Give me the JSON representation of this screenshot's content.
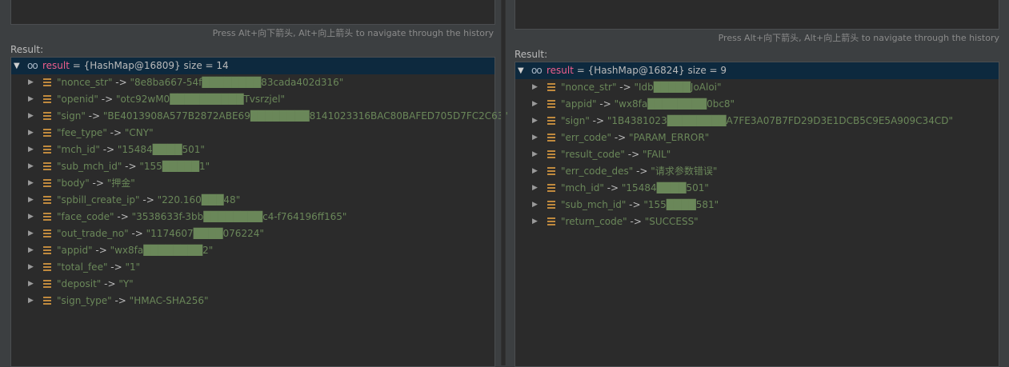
{
  "left": {
    "hint": "Press Alt+向下箭头, Alt+向上箭头 to navigate through the history",
    "result_label": "Result:",
    "root": {
      "name": "result",
      "equals": " = ",
      "type": "{HashMap@16809}",
      "size": "  size = 14"
    },
    "entries": [
      {
        "key": "\"nonce_str\"",
        "value": "\"8e8ba667-54f████████83cada402d316\""
      },
      {
        "key": "\"openid\"",
        "value": "\"otc92wM0██████████Tvsrzjel\""
      },
      {
        "key": "\"sign\"",
        "value": "\"BE4013908A577B2872ABE69████████8141023316BAC80BAFED705D7FC2C63\""
      },
      {
        "key": "\"fee_type\"",
        "value": "\"CNY\""
      },
      {
        "key": "\"mch_id\"",
        "value": "\"15484████501\""
      },
      {
        "key": "\"sub_mch_id\"",
        "value": "\"155█████1\""
      },
      {
        "key": "\"body\"",
        "value": "\"押金\""
      },
      {
        "key": "\"spbill_create_ip\"",
        "value": "\"220.160███48\""
      },
      {
        "key": "\"face_code\"",
        "value": "\"3538633f-3bb████████c4-f764196ff165\""
      },
      {
        "key": "\"out_trade_no\"",
        "value": "\"1174607████076224\""
      },
      {
        "key": "\"appid\"",
        "value": "\"wx8fa████████2\""
      },
      {
        "key": "\"total_fee\"",
        "value": "\"1\""
      },
      {
        "key": "\"deposit\"",
        "value": "\"Y\""
      },
      {
        "key": "\"sign_type\"",
        "value": "\"HMAC-SHA256\""
      }
    ]
  },
  "right": {
    "hint": "Press Alt+向下箭头, Alt+向上箭头 to navigate through the history",
    "result_label": "Result:",
    "root": {
      "name": "result",
      "equals": " = ",
      "type": "{HashMap@16824}",
      "size": "  size = 9"
    },
    "entries": [
      {
        "key": "\"nonce_str\"",
        "value": "\"Idb█████JoAloi\""
      },
      {
        "key": "\"appid\"",
        "value": "\"wx8fa████████0bc8\""
      },
      {
        "key": "\"sign\"",
        "value": "\"1B4381023████████A7FE3A07B7FD29D3E1DCB5C9E5A909C34CD\""
      },
      {
        "key": "\"err_code\"",
        "value": "\"PARAM_ERROR\""
      },
      {
        "key": "\"result_code\"",
        "value": "\"FAIL\""
      },
      {
        "key": "\"err_code_des\"",
        "value": "\"请求参数错误\""
      },
      {
        "key": "\"mch_id\"",
        "value": "\"15484████501\""
      },
      {
        "key": "\"sub_mch_id\"",
        "value": "\"155████581\""
      },
      {
        "key": "\"return_code\"",
        "value": "\"SUCCESS\""
      }
    ]
  },
  "icons": {
    "expand_open": "triangle-down",
    "expand_closed": "triangle-right",
    "watch": "glasses",
    "field": "field-bars"
  },
  "colors": {
    "background": "#3c3f41",
    "tree_bg": "#2b2b2b",
    "selected_row": "#0d293e",
    "string": "#6a8759",
    "var_name": "#ee5e8c",
    "field_icon": "#c08a3e"
  }
}
